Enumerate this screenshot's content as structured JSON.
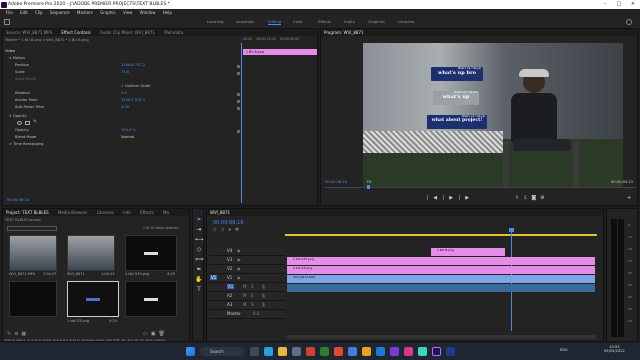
{
  "app": {
    "title": "Adobe Premiere Pro 2020 - J:\\ADOBE PREMIER PROJECTS\\TEXT BLBLES *"
  },
  "menus": [
    "File",
    "Edit",
    "Clip",
    "Sequence",
    "Markers",
    "Graphic",
    "View",
    "Window",
    "Help"
  ],
  "workspaces": [
    {
      "label": "Learning",
      "active": false
    },
    {
      "label": "Assembly",
      "active": false
    },
    {
      "label": "Editing",
      "active": true
    },
    {
      "label": "Color",
      "active": false
    },
    {
      "label": "Effects",
      "active": false
    },
    {
      "label": "Audio",
      "active": false
    },
    {
      "label": "Graphics",
      "active": false
    },
    {
      "label": "Libraries",
      "active": false
    }
  ],
  "source_panel": {
    "tabs": [
      "Source: WVI_8871.MP4",
      "Effect Controls",
      "Audio Clip Mixer: WVI_8871",
      "Metadata"
    ],
    "master_line": "Master * 1 BU B.png ∨  WVI_8871 * 1 BU B.png",
    "ruler": [
      "00:00",
      "00:00:15:00",
      "00:00:30:00"
    ],
    "clip_chip": "1 BU B.png",
    "sections": [
      "Video",
      "Motion",
      "Opacity",
      "Time Remapping"
    ],
    "props": [
      {
        "label": "Position",
        "value": "1204.8    727.2"
      },
      {
        "label": "Scale",
        "value": "74.6"
      },
      {
        "label": "Scale Width",
        "value": ""
      },
      {
        "label": "",
        "value": "✓ Uniform Scale"
      },
      {
        "label": "Rotation",
        "value": "0.0"
      },
      {
        "label": "Anchor Point",
        "value": "1206.2    978.5"
      },
      {
        "label": "Anti-flicker Filter",
        "value": "0.00"
      },
      {
        "label": "Opacity",
        "value": "100.0 %"
      },
      {
        "label": "Blend Mode",
        "value": "Normal"
      }
    ],
    "timecode": "00:00:08:16"
  },
  "program": {
    "tab": "Program: WVI_8871",
    "timecode": "00:00:08:16",
    "fit": "Fit",
    "duration": "00:00:04:23",
    "captions": [
      {
        "small": "What's Up 7:46 pm",
        "text": "what's up bro"
      },
      {
        "small": "What's Up 7:46 pm",
        "text": "what's up"
      },
      {
        "small": "What's Up 7:46 pm",
        "text": "what about project!"
      }
    ]
  },
  "project": {
    "tabs": [
      "Project: TEXT BLBLES",
      "Media Browser",
      "Libraries",
      "Info",
      "Effects",
      "Ma"
    ],
    "path": "TEXT BLBLES.prproj",
    "count": "1 of 10 items selected",
    "items": [
      {
        "name": "WVI_8871.MP4",
        "dur": "1:04:23"
      },
      {
        "name": "WVI_8871",
        "dur": "1:04:23"
      },
      {
        "name": "1 bbl 033.png",
        "dur": "4:29"
      },
      {
        "name": "",
        "dur": ""
      },
      {
        "name": "1 bbl 03.png",
        "dur": "4:29"
      },
      {
        "name": "",
        "dur": ""
      }
    ]
  },
  "timeline": {
    "tab": "WVI_8871",
    "timecode": "00:00:08:16",
    "tracks": [
      "V4",
      "V3",
      "V2",
      "V1",
      "A1",
      "A2",
      "A3"
    ],
    "master": "Master",
    "master_val": "0.0",
    "clips": [
      {
        "name": "1 BU B.png",
        "track": "V4"
      },
      {
        "name": "1 bbl 033.png",
        "track": "V3"
      },
      {
        "name": "1 bbl 03.png",
        "track": "V2"
      },
      {
        "name": "WVI_8871.MP4",
        "track": "V1"
      }
    ]
  },
  "meter": {
    "ticks": [
      "-6",
      "-12",
      "-18",
      "-24",
      "-30",
      "-36",
      "-42",
      "-48",
      "-54"
    ]
  },
  "status": "Click to select, or click in empty space and drag to marquee select. Use Shift, Alt, and Ctrl for other options.",
  "taskbar": {
    "search": "Search",
    "time": "10:53",
    "date": "09/05/2022",
    "lang": "ENG"
  },
  "colors": {
    "accent": "#4b8bef",
    "clip_pink": "#e58de6",
    "clip_blue": "#7ea3e6",
    "caption_navy": "#1c2f6e"
  }
}
